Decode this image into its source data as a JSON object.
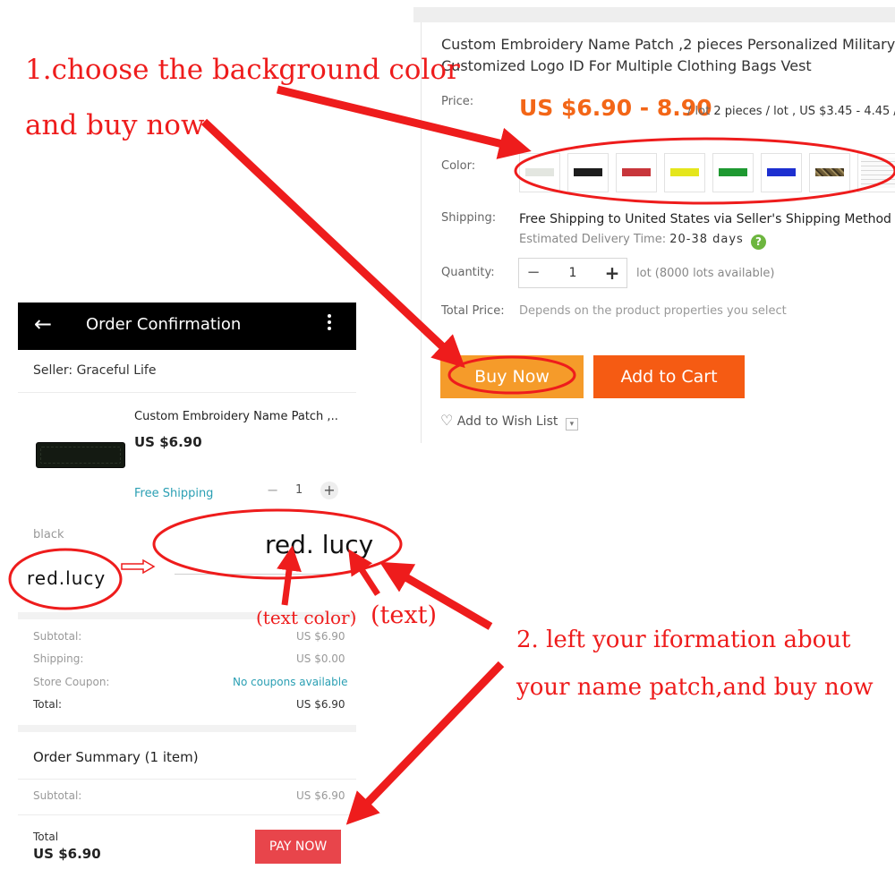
{
  "product": {
    "title_line1": "Custom Embroidery Name Patch ,2 pieces Personalized Military",
    "title_line2": "Customized Logo ID For Multiple Clothing Bags Vest",
    "price_label": "Price:",
    "price_main": "US $6.90 - 8.90",
    "price_unit": "/ lot",
    "price_pieces": "2 pieces / lot",
    "price_sep": ",",
    "price_per_piece": "US $3.45 - 4.45 /",
    "color_label": "Color:",
    "swatches": [
      {
        "name": "white",
        "color": "#e3e6e0"
      },
      {
        "name": "black",
        "color": "#1d1d1d"
      },
      {
        "name": "red",
        "color": "#c8363b"
      },
      {
        "name": "yellow",
        "color": "#e5e61c"
      },
      {
        "name": "green",
        "color": "#1e9931"
      },
      {
        "name": "blue",
        "color": "#1d2fd0"
      },
      {
        "name": "camo",
        "color": "#6b5a35"
      },
      {
        "name": "size-chart",
        "color": "#f4f4f4"
      }
    ],
    "shipping_label": "Shipping:",
    "shipping_free": "Free Shipping to",
    "shipping_dest": "United States via Seller's Shipping Method",
    "delivery_label": "Estimated Delivery Time:",
    "delivery_days": "20-38 days",
    "quantity_label": "Quantity:",
    "quantity_value": "1",
    "quantity_available": "lot (8000 lots available)",
    "total_label": "Total Price:",
    "total_text": "Depends on the product properties you select",
    "buy_now": "Buy Now",
    "add_to_cart": "Add to Cart",
    "wish_list": "Add to Wish List"
  },
  "order": {
    "header_title": "Order Confirmation",
    "seller": "Seller: Graceful Life",
    "item_title": "Custom Embroidery Name Patch ,..",
    "item_price": "US $6.90",
    "free_shipping": "Free Shipping",
    "qty": "1",
    "variant": "black",
    "note_text": "red. lucy",
    "subtotal_label": "Subtotal:",
    "subtotal_value": "US $6.90",
    "shipping_label": "Shipping:",
    "shipping_value": "US $0.00",
    "coupon_label": "Store Coupon:",
    "coupon_value": "No coupons available",
    "total_label": "Total:",
    "total_value": "US $6.90",
    "summary_title": "Order Summary (1 item)",
    "summary_subtotal_label": "Subtotal:",
    "summary_subtotal_value": "US $6.90",
    "footer_total_label": "Total",
    "footer_total_value": "US $6.90",
    "pay_now": "PAY NOW"
  },
  "annotations": {
    "step1_line1": "1.choose the background color",
    "step1_line2": "and buy now",
    "example_text": "red.lucy",
    "text_color_label": "(text color)",
    "text_label": "(text)",
    "step2_line1": "2. left your iformation about",
    "step2_line2": "your name patch,and buy now",
    "accent_color": "#ee1c1c"
  }
}
